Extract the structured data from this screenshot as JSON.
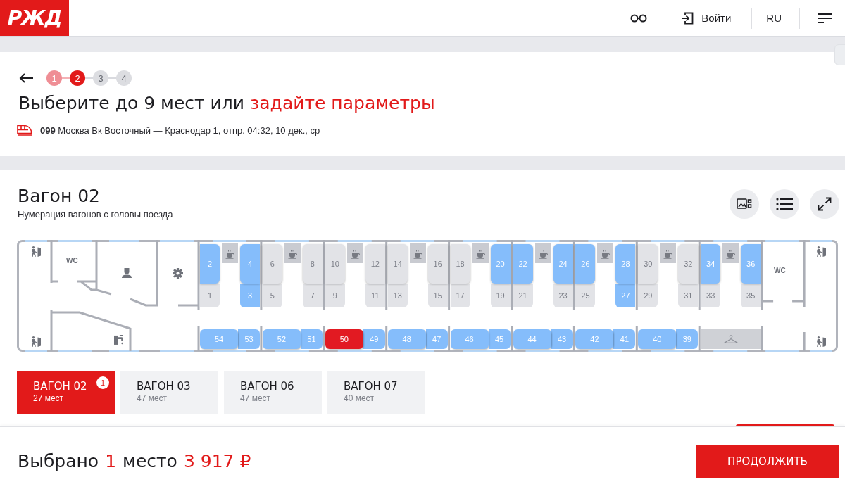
{
  "header": {
    "logo": "РЖД",
    "login": "Войти",
    "language": "RU"
  },
  "steps": [
    {
      "label": "1",
      "completed": true,
      "selected": false
    },
    {
      "label": "2",
      "completed": false,
      "selected": true
    },
    {
      "label": "3",
      "completed": false,
      "selected": false
    },
    {
      "label": "4",
      "completed": false,
      "selected": false
    }
  ],
  "title": {
    "text": "Выберите до 9 мест или",
    "link": "задайте параметры"
  },
  "train": {
    "info": "**099** Москва Вк Восточный — Краснодар 1, отпр. 04:32, 10 дек., ср"
  },
  "car": {
    "title": "Вагон 02",
    "subtitle": "Нумерация вагонов с головы поезда",
    "map": {
      "wc_labels": [
        "WC",
        "WC"
      ],
      "compartments": [
        {
          "berths": [
            {
              "number": "2",
              "available": true,
              "selected": false
            },
            {
              "number": "1",
              "available": false,
              "selected": false
            },
            {
              "number": "4",
              "available": true,
              "selected": false
            },
            {
              "number": "3",
              "available": true,
              "selected": false
            }
          ],
          "side_berths": [
            {
              "number": "54",
              "available": true,
              "selected": false
            },
            {
              "number": "53",
              "available": true,
              "selected": false
            }
          ]
        },
        {
          "berths": [
            {
              "number": "6",
              "available": false,
              "selected": false
            },
            {
              "number": "5",
              "available": false,
              "selected": false
            },
            {
              "number": "8",
              "available": false,
              "selected": false
            },
            {
              "number": "7",
              "available": false,
              "selected": false
            }
          ],
          "side_berths": [
            {
              "number": "52",
              "available": true,
              "selected": false
            },
            {
              "number": "51",
              "available": true,
              "selected": false
            }
          ]
        },
        {
          "berths": [
            {
              "number": "10",
              "available": false,
              "selected": false
            },
            {
              "number": "9",
              "available": false,
              "selected": false
            },
            {
              "number": "12",
              "available": false,
              "selected": false
            },
            {
              "number": "11",
              "available": false,
              "selected": false
            }
          ],
          "side_berths": [
            {
              "number": "50",
              "available": true,
              "selected": true
            },
            {
              "number": "49",
              "available": true,
              "selected": false
            }
          ]
        },
        {
          "berths": [
            {
              "number": "14",
              "available": false,
              "selected": false
            },
            {
              "number": "13",
              "available": false,
              "selected": false
            },
            {
              "number": "16",
              "available": false,
              "selected": false
            },
            {
              "number": "15",
              "available": false,
              "selected": false
            }
          ],
          "side_berths": [
            {
              "number": "48",
              "available": true,
              "selected": false
            },
            {
              "number": "47",
              "available": true,
              "selected": false
            }
          ]
        },
        {
          "berths": [
            {
              "number": "18",
              "available": false,
              "selected": false
            },
            {
              "number": "17",
              "available": false,
              "selected": false
            },
            {
              "number": "20",
              "available": true,
              "selected": false
            },
            {
              "number": "19",
              "available": false,
              "selected": false
            }
          ],
          "side_berths": [
            {
              "number": "46",
              "available": true,
              "selected": false
            },
            {
              "number": "45",
              "available": true,
              "selected": false
            }
          ]
        },
        {
          "berths": [
            {
              "number": "22",
              "available": true,
              "selected": false
            },
            {
              "number": "21",
              "available": false,
              "selected": false
            },
            {
              "number": "24",
              "available": true,
              "selected": false
            },
            {
              "number": "23",
              "available": false,
              "selected": false
            }
          ],
          "side_berths": [
            {
              "number": "44",
              "available": true,
              "selected": false
            },
            {
              "number": "43",
              "available": true,
              "selected": false
            }
          ]
        },
        {
          "berths": [
            {
              "number": "26",
              "available": true,
              "selected": false
            },
            {
              "number": "25",
              "available": false,
              "selected": false
            },
            {
              "number": "28",
              "available": true,
              "selected": false
            },
            {
              "number": "27",
              "available": true,
              "selected": false
            }
          ],
          "side_berths": [
            {
              "number": "42",
              "available": true,
              "selected": false
            },
            {
              "number": "41",
              "available": true,
              "selected": false
            }
          ]
        },
        {
          "berths": [
            {
              "number": "30",
              "available": false,
              "selected": false
            },
            {
              "number": "29",
              "available": false,
              "selected": false
            },
            {
              "number": "32",
              "available": false,
              "selected": false
            },
            {
              "number": "31",
              "available": false,
              "selected": false
            }
          ],
          "side_berths": [
            {
              "number": "40",
              "available": true,
              "selected": false
            },
            {
              "number": "39",
              "available": true,
              "selected": false
            }
          ]
        },
        {
          "berths": [
            {
              "number": "34",
              "available": true,
              "selected": false
            },
            {
              "number": "33",
              "available": false,
              "selected": false
            },
            {
              "number": "36",
              "available": true,
              "selected": false
            },
            {
              "number": "35",
              "available": false,
              "selected": false
            }
          ]
        }
      ]
    }
  },
  "car_tabs": [
    {
      "title": "ВАГОН 02",
      "seats": "27 мест",
      "selected": true,
      "badge": "1"
    },
    {
      "title": "ВАГОН 03",
      "seats": "47 мест",
      "selected": false
    },
    {
      "title": "ВАГОН 06",
      "seats": "47 мест",
      "selected": false
    },
    {
      "title": "ВАГОН 07",
      "seats": "40 мест",
      "selected": false
    }
  ],
  "summary": {
    "label": "Выбрано",
    "count": "1",
    "unit": "место",
    "price": "3 917 ₽"
  },
  "continue_button": "ПРОДОЛЖИТЬ"
}
